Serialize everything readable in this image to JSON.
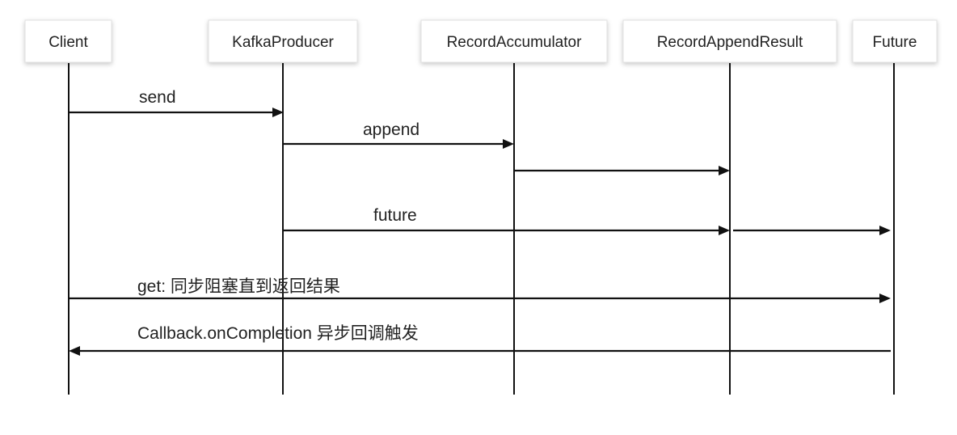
{
  "participants": [
    {
      "id": "client",
      "label": "Client"
    },
    {
      "id": "producer",
      "label": "KafkaProducer"
    },
    {
      "id": "accumulator",
      "label": "RecordAccumulator"
    },
    {
      "id": "result",
      "label": "RecordAppendResult"
    },
    {
      "id": "future",
      "label": "Future"
    }
  ],
  "messages": [
    {
      "id": "send",
      "label": "send",
      "from": "client",
      "to": "producer"
    },
    {
      "id": "append",
      "label": "append",
      "from": "producer",
      "to": "accumulator"
    },
    {
      "id": "append-return",
      "label": "",
      "from": "accumulator",
      "to": "result"
    },
    {
      "id": "future",
      "label": "future",
      "from": "producer",
      "to": "result"
    },
    {
      "id": "future-continue",
      "label": "",
      "from": "result",
      "to": "future"
    },
    {
      "id": "get",
      "label": "get: 同步阻塞直到返回结果",
      "from": "client",
      "to": "future"
    },
    {
      "id": "callback",
      "label": "Callback.onCompletion 异步回调触发",
      "from": "future",
      "to": "client"
    }
  ]
}
